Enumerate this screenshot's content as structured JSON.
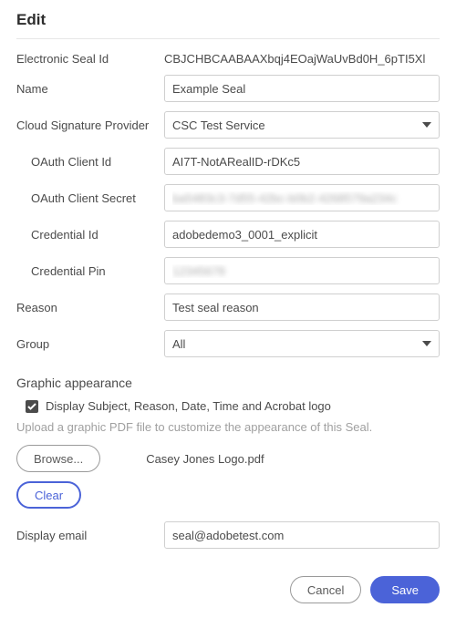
{
  "title": "Edit",
  "fields": {
    "seal_id_label": "Electronic Seal Id",
    "seal_id_value": "CBJCHBCAABAAXbqj4EOajWaUvBd0H_6pTI5Xl",
    "name_label": "Name",
    "name_value": "Example Seal",
    "csp_label": "Cloud Signature Provider",
    "csp_value": "CSC Test Service",
    "oauth_id_label": "OAuth Client Id",
    "oauth_id_value": "AI7T-NotARealID-rDKc5",
    "oauth_secret_label": "OAuth Client Secret",
    "oauth_secret_value": "ba5483c3-7d55-42bc-b0b2-4268579a234c",
    "cred_id_label": "Credential Id",
    "cred_id_value": "adobedemo3_0001_explicit",
    "cred_pin_label": "Credential Pin",
    "cred_pin_value": "12345678",
    "reason_label": "Reason",
    "reason_value": "Test seal reason",
    "group_label": "Group",
    "group_value": "All"
  },
  "graphic": {
    "section_title": "Graphic appearance",
    "checkbox_label": "Display Subject, Reason, Date, Time and Acrobat logo",
    "hint": "Upload a graphic PDF file to customize the appearance of this Seal.",
    "browse_label": "Browse...",
    "filename": "Casey Jones Logo.pdf",
    "clear_label": "Clear",
    "email_label": "Display email",
    "email_value": "seal@adobetest.com"
  },
  "footer": {
    "cancel": "Cancel",
    "save": "Save"
  }
}
